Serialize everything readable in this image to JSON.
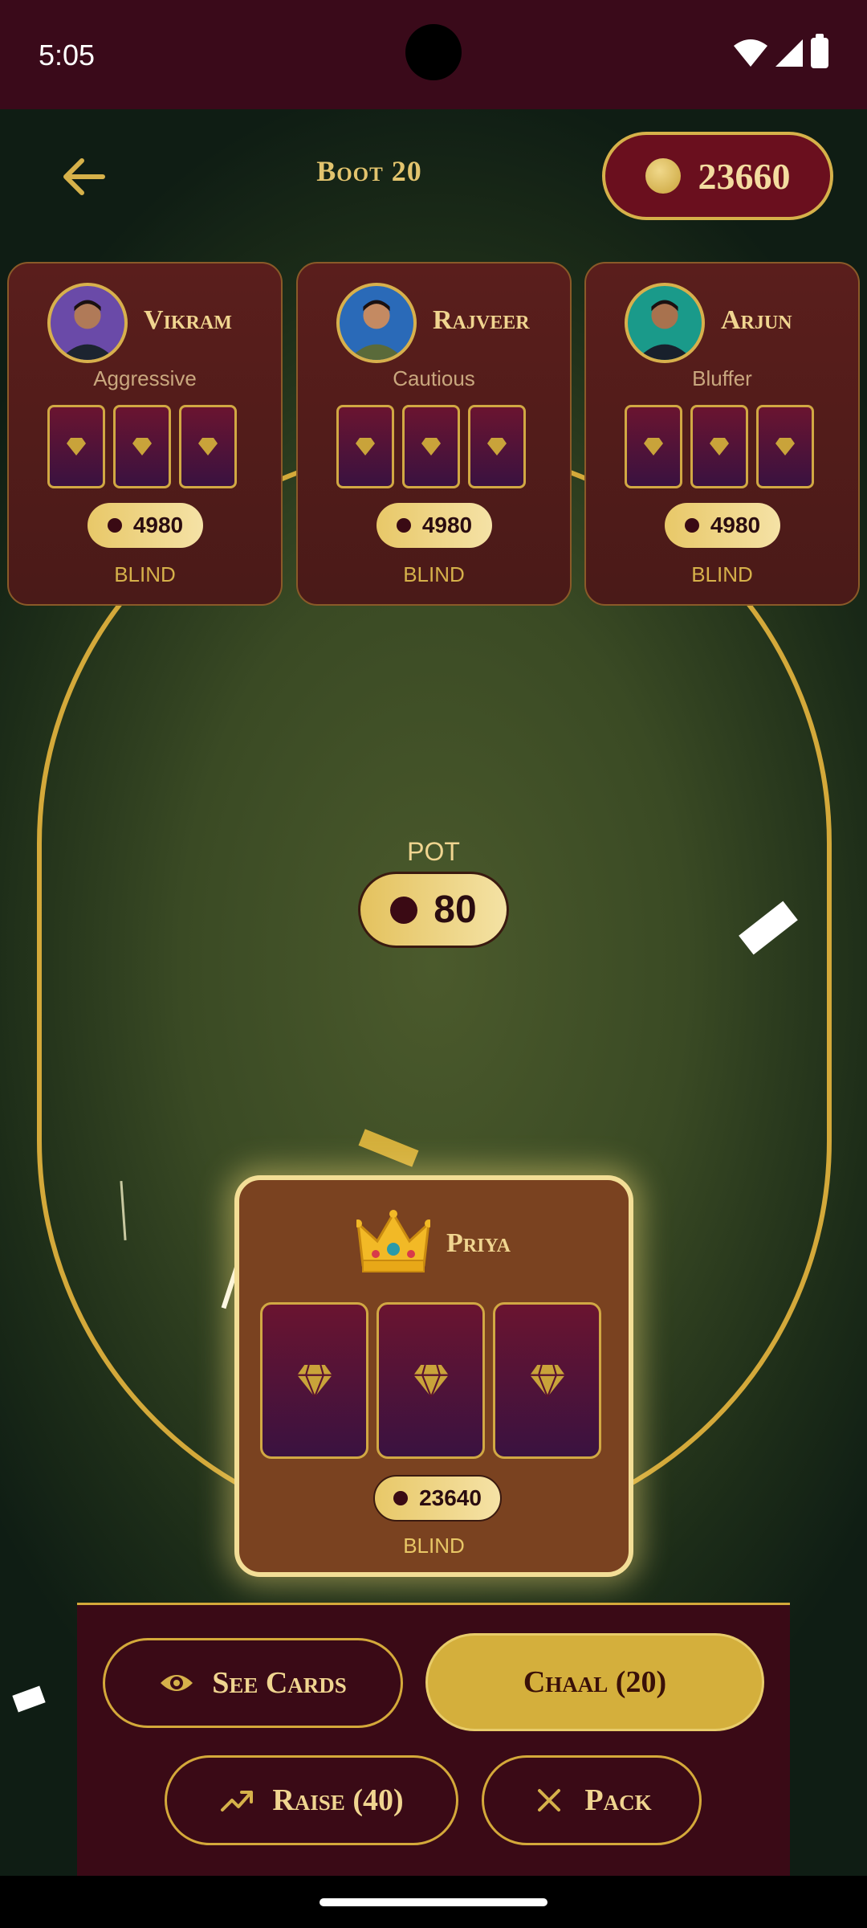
{
  "status_bar": {
    "time": "5:05"
  },
  "header": {
    "title": "Boot 20",
    "coins": "23660"
  },
  "opponents": [
    {
      "name": "Vikram",
      "style": "Aggressive",
      "chips": "4980",
      "status": "BLIND",
      "avatar_bg": "#6a4aa8"
    },
    {
      "name": "Rajveer",
      "style": "Cautious",
      "chips": "4980",
      "status": "BLIND",
      "avatar_bg": "#2a6ab8"
    },
    {
      "name": "Arjun",
      "style": "Bluffer",
      "chips": "4980",
      "status": "BLIND",
      "avatar_bg": "#1a9a8a"
    }
  ],
  "pot": {
    "label": "POT",
    "value": "80"
  },
  "player": {
    "name": "Priya",
    "chips": "23640",
    "status": "BLIND",
    "icon": "crown-icon"
  },
  "actions": {
    "see_cards": "See Cards",
    "chaal": "Chaal (20)",
    "raise": "Raise (40)",
    "pack": "Pack"
  },
  "colors": {
    "accent_gold": "#d4a93a",
    "panel_maroon": "#3a0a16",
    "felt_green": "#4b5a2c"
  }
}
